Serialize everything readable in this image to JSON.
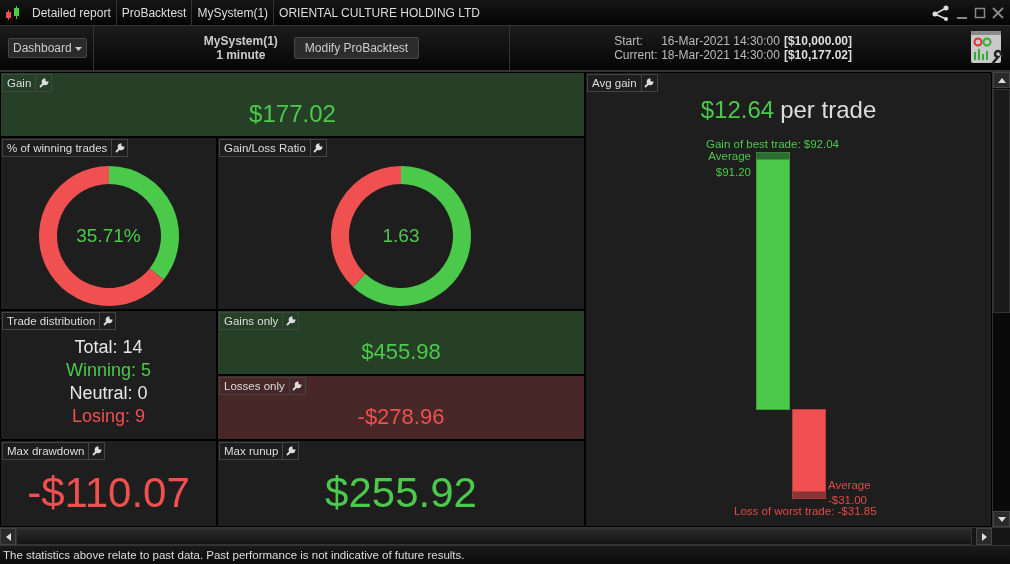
{
  "title_bar": {
    "tabs": [
      {
        "label": "Detailed report"
      },
      {
        "label": "ProBacktest"
      },
      {
        "label": "MySystem(1)"
      },
      {
        "label": "ORIENTAL CULTURE HOLDING LTD"
      }
    ]
  },
  "toolbar": {
    "view_menu": "Dashboard",
    "system_name": "MySystem(1)",
    "timeframe": "1 minute",
    "modify_button": "Modify ProBacktest",
    "start": {
      "label": "Start:",
      "date": "16-Mar-2021 14:30:00",
      "capital": "[$10,000.00]"
    },
    "current": {
      "label": "Current:",
      "date": "18-Mar-2021 14:30:00",
      "capital": "[$10,177.02]"
    }
  },
  "panels": {
    "gain": {
      "title": "Gain",
      "value": "$177.02",
      "kind": "gain"
    },
    "winning_trades": {
      "title": "% of winning trades",
      "value": "35.71%",
      "chart_data": {
        "type": "donut",
        "values": [
          35.71,
          64.29
        ]
      }
    },
    "gain_loss_ratio": {
      "title": "Gain/Loss Ratio",
      "value": "1.63",
      "chart_data": {
        "type": "donut",
        "values": [
          62.04,
          37.96
        ]
      }
    },
    "trade_distribution": {
      "title": "Trade distribution",
      "lines": [
        {
          "text": "Total: 14",
          "kind": "neutral"
        },
        {
          "text": "Winning: 5",
          "kind": "gain"
        },
        {
          "text": "Neutral: 0",
          "kind": "neutral"
        },
        {
          "text": "Losing: 9",
          "kind": "loss"
        }
      ]
    },
    "gains_only": {
      "title": "Gains only",
      "value": "$455.98",
      "kind": "gain"
    },
    "losses_only": {
      "title": "Losses only",
      "value": "-$278.96",
      "kind": "loss"
    },
    "max_drawdown": {
      "title": "Max drawdown",
      "value": "-$110.07",
      "kind": "loss"
    },
    "max_runup": {
      "title": "Max runup",
      "value": "$255.92",
      "kind": "gain"
    },
    "avg_gain": {
      "title": "Avg gain",
      "value": "$12.64",
      "unit": "per trade",
      "best_trade": "Gain of best trade: $92.04",
      "gain_average_label": "Average",
      "gain_average_value": "$91.20",
      "loss_average_label": "Average",
      "loss_average_value": "-$31.00",
      "worst_trade": "Loss of worst trade: -$31.85"
    }
  },
  "disclaimer": "The statistics above relate to past data. Past performance is not indicative of future results."
}
